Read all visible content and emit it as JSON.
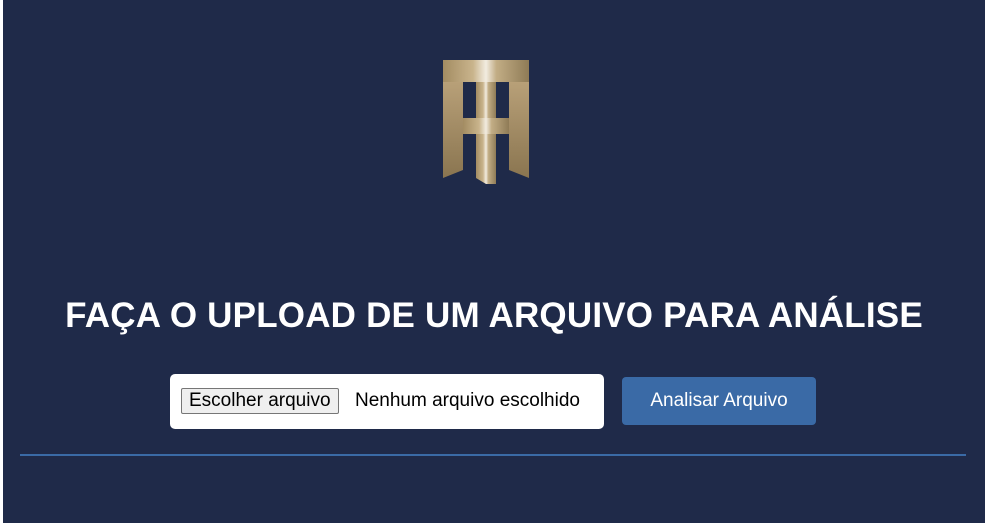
{
  "page": {
    "heading": "FAÇA O UPLOAD DE UM ARQUIVO PARA ANÁLISE"
  },
  "logo": {
    "icon": "th-monogram-logo",
    "colors": [
      "#b9a27a",
      "#e6ddcb",
      "#8c7a59"
    ]
  },
  "upload": {
    "choose_label": "Escolher arquivo",
    "status_text": "Nenhum arquivo escolhido"
  },
  "actions": {
    "analyze_label": "Analisar Arquivo"
  },
  "colors": {
    "background": "#1f2a49",
    "accent": "#3a6aa6",
    "text": "#ffffff"
  }
}
